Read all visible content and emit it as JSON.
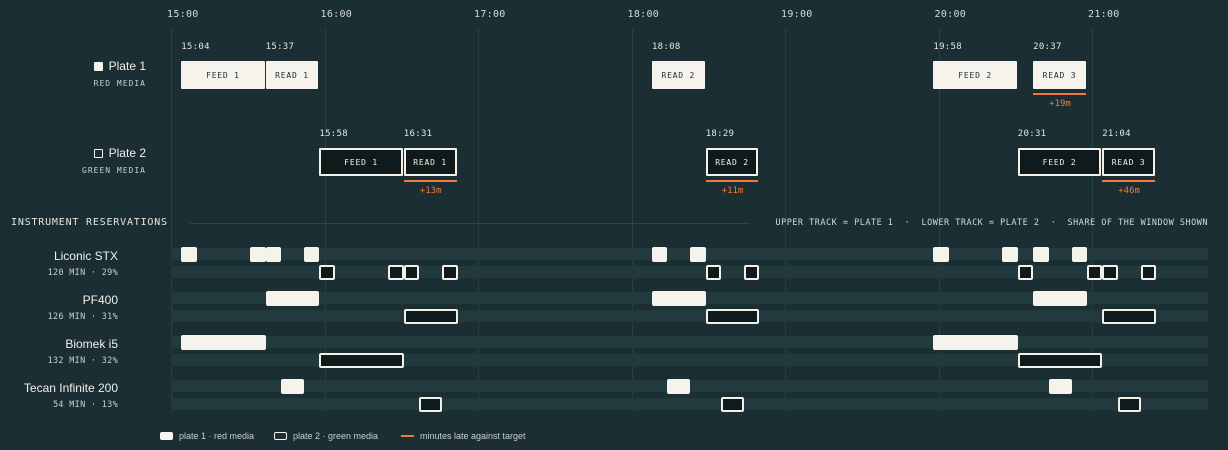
{
  "axis": {
    "hours": [
      "15:00",
      "16:00",
      "17:00",
      "18:00",
      "19:00",
      "20:00",
      "21:00"
    ]
  },
  "plates": [
    {
      "label": "Plate 1",
      "sub": "RED MEDIA",
      "style": "filled",
      "tasks": [
        {
          "label": "FEED 1",
          "time": "15:04",
          "start": "15:04",
          "end": "15:37"
        },
        {
          "label": "READ 1",
          "time": "15:37",
          "start": "15:37",
          "end": "15:58"
        },
        {
          "label": "READ 2",
          "time": "18:08",
          "start": "18:08",
          "end": "18:29"
        },
        {
          "label": "FEED 2",
          "time": "19:58",
          "start": "19:58",
          "end": "20:31"
        },
        {
          "label": "READ 3",
          "time": "20:37",
          "start": "20:37",
          "end": "20:58",
          "late": "+19m"
        }
      ]
    },
    {
      "label": "Plate 2",
      "sub": "GREEN MEDIA",
      "style": "outline",
      "tasks": [
        {
          "label": "FEED 1",
          "time": "15:58",
          "start": "15:58",
          "end": "16:31"
        },
        {
          "label": "READ 1",
          "time": "16:31",
          "start": "16:31",
          "end": "16:52",
          "late": "+13m"
        },
        {
          "label": "READ 2",
          "time": "18:29",
          "start": "18:29",
          "end": "18:50",
          "late": "+11m"
        },
        {
          "label": "FEED 2",
          "time": "20:31",
          "start": "20:31",
          "end": "21:04"
        },
        {
          "label": "READ 3",
          "time": "21:04",
          "start": "21:04",
          "end": "21:25",
          "late": "+46m"
        }
      ]
    }
  ],
  "reservations": {
    "title": "INSTRUMENT RESERVATIONS",
    "note": "UPPER TRACK = PLATE 1  ·  LOWER TRACK = PLATE 2  ·  SHARE OF THE WINDOW SHOWN",
    "instruments": [
      {
        "name": "Liconic STX",
        "stats": "120 MIN · 29%",
        "plate1": [
          [
            "15:04",
            "15:10"
          ],
          [
            "15:31",
            "15:37"
          ],
          [
            "15:37",
            "15:43"
          ],
          [
            "15:52",
            "15:58"
          ],
          [
            "18:08",
            "18:14"
          ],
          [
            "18:23",
            "18:29"
          ],
          [
            "19:58",
            "20:04"
          ],
          [
            "20:25",
            "20:31"
          ],
          [
            "20:37",
            "20:43"
          ],
          [
            "20:52",
            "20:58"
          ]
        ],
        "plate2": [
          [
            "15:58",
            "16:04"
          ],
          [
            "16:25",
            "16:31"
          ],
          [
            "16:31",
            "16:37"
          ],
          [
            "16:46",
            "16:52"
          ],
          [
            "18:29",
            "18:35"
          ],
          [
            "18:44",
            "18:50"
          ],
          [
            "20:31",
            "20:37"
          ],
          [
            "20:58",
            "21:04"
          ],
          [
            "21:04",
            "21:10"
          ],
          [
            "21:19",
            "21:25"
          ]
        ]
      },
      {
        "name": "PF400",
        "stats": "126 MIN · 31%",
        "plate1": [
          [
            "15:37",
            "15:58"
          ],
          [
            "18:08",
            "18:29"
          ],
          [
            "20:37",
            "20:58"
          ]
        ],
        "plate2": [
          [
            "16:31",
            "16:52"
          ],
          [
            "18:29",
            "18:50"
          ],
          [
            "21:04",
            "21:25"
          ]
        ]
      },
      {
        "name": "Biomek i5",
        "stats": "132 MIN · 32%",
        "plate1": [
          [
            "15:04",
            "15:37"
          ],
          [
            "19:58",
            "20:31"
          ]
        ],
        "plate2": [
          [
            "15:58",
            "16:31"
          ],
          [
            "20:31",
            "21:04"
          ]
        ]
      },
      {
        "name": "Tecan Infinite 200",
        "stats": "54 MIN · 13%",
        "plate1": [
          [
            "15:43",
            "15:52"
          ],
          [
            "18:14",
            "18:23"
          ],
          [
            "20:43",
            "20:52"
          ]
        ],
        "plate2": [
          [
            "16:37",
            "16:46"
          ],
          [
            "18:35",
            "18:44"
          ],
          [
            "21:10",
            "21:19"
          ]
        ]
      }
    ]
  },
  "legend": [
    {
      "label": "plate 1 · red media",
      "style": "filled"
    },
    {
      "label": "plate 2 · green media",
      "style": "outline"
    },
    {
      "label": "minutes late against target",
      "style": "line"
    }
  ],
  "colors": {
    "background": "#1b2e33",
    "fill": "#f6f3ec",
    "late": "#f07a3c",
    "track": "#22393e"
  }
}
